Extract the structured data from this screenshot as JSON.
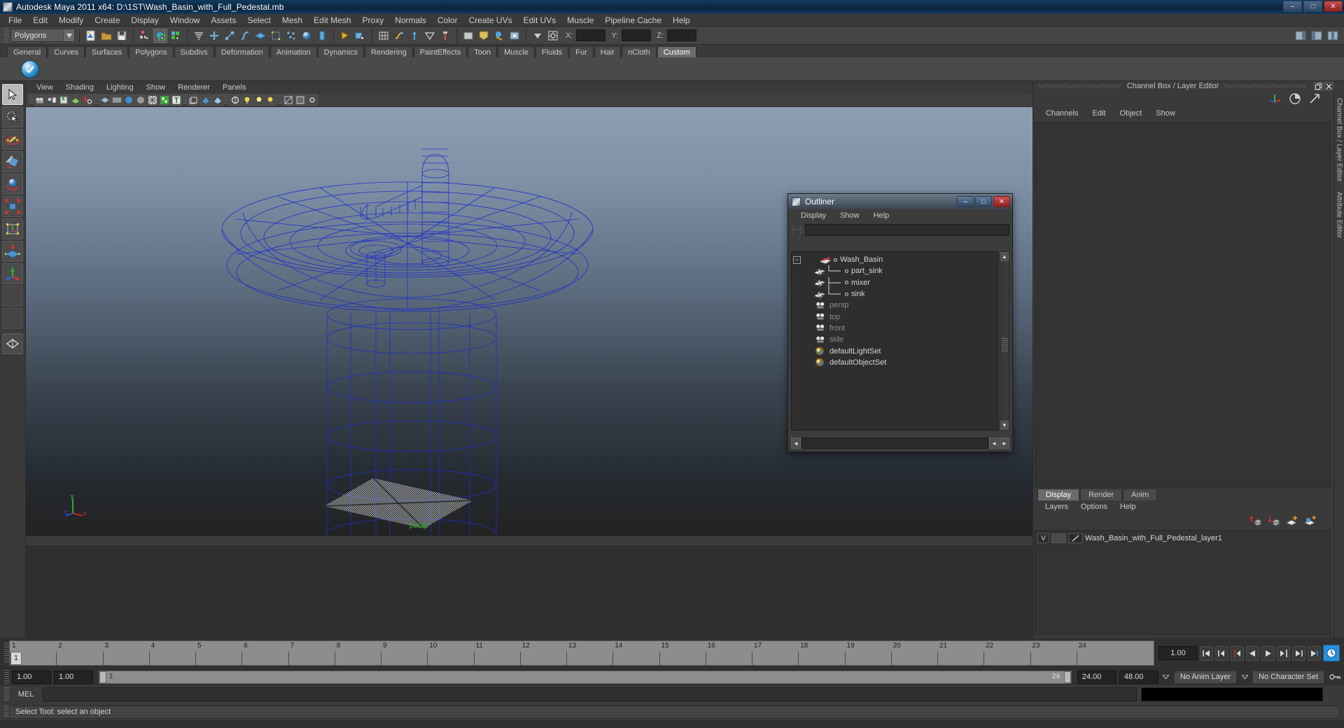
{
  "window": {
    "title": "Autodesk Maya 2011 x64: D:\\1ST\\Wash_Basin_with_Full_Pedestal.mb",
    "icon": "maya-icon",
    "minimize": "–",
    "maximize": "□",
    "close": "✕"
  },
  "menubar": {
    "items": [
      "File",
      "Edit",
      "Modify",
      "Create",
      "Display",
      "Window",
      "Assets",
      "Select",
      "Mesh",
      "Edit Mesh",
      "Proxy",
      "Normals",
      "Color",
      "Create UVs",
      "Edit UVs",
      "Muscle",
      "Pipeline Cache",
      "Help"
    ]
  },
  "statusline": {
    "menuset": "Polygons",
    "coords": {
      "x_label": "X:",
      "y_label": "Y:",
      "z_label": "Z:",
      "x_value": "",
      "y_value": "",
      "z_value": ""
    }
  },
  "shelf": {
    "tabs": [
      "General",
      "Curves",
      "Surfaces",
      "Polygons",
      "Subdivs",
      "Deformation",
      "Animation",
      "Dynamics",
      "Rendering",
      "PaintEffects",
      "Toon",
      "Muscle",
      "Fluids",
      "Fur",
      "Hair",
      "nCloth",
      "Custom"
    ],
    "active_tab": "Custom",
    "icon_name": "check-circle-icon"
  },
  "toolbox": {
    "tools": [
      "select-tool",
      "lasso-select-tool",
      "paint-select-tool",
      "move-tool",
      "rotate-tool",
      "scale-tool",
      "universal-manipulator-tool",
      "soft-modification-tool",
      "show-manipulator-tool",
      "blank-slot-1",
      "blank-slot-2"
    ],
    "selected": "select-tool"
  },
  "viewport": {
    "menus": [
      "View",
      "Shading",
      "Lighting",
      "Show",
      "Renderer",
      "Panels"
    ],
    "camera_label": "persp",
    "axis": {
      "x": "x",
      "y": "y",
      "z": "z"
    }
  },
  "outliner": {
    "title": "Outliner",
    "icon": "maya-icon",
    "minimize": "–",
    "maximize": "□",
    "close": "✕",
    "menus": [
      "Display",
      "Show",
      "Help"
    ],
    "search_value": "",
    "search_placeholder": "",
    "expand_toggle": "−",
    "tree": [
      {
        "label": "Wash_Basin",
        "icon": "transform-icon",
        "depth": 0,
        "dim": false,
        "expander": true
      },
      {
        "label": "part_sink",
        "icon": "mesh-icon",
        "depth": 1,
        "dim": false,
        "expander": false
      },
      {
        "label": "mixer",
        "icon": "mesh-icon",
        "depth": 1,
        "dim": false,
        "expander": false
      },
      {
        "label": "sink",
        "icon": "mesh-icon",
        "depth": 1,
        "dim": false,
        "expander": false
      },
      {
        "label": "persp",
        "icon": "camera-icon",
        "depth": 0,
        "dim": true,
        "expander": false
      },
      {
        "label": "top",
        "icon": "camera-icon",
        "depth": 0,
        "dim": true,
        "expander": false
      },
      {
        "label": "front",
        "icon": "camera-icon",
        "depth": 0,
        "dim": true,
        "expander": false
      },
      {
        "label": "side",
        "icon": "camera-icon",
        "depth": 0,
        "dim": true,
        "expander": false
      },
      {
        "label": "defaultLightSet",
        "icon": "set-icon",
        "depth": 0,
        "dim": false,
        "expander": false
      },
      {
        "label": "defaultObjectSet",
        "icon": "set-icon",
        "depth": 0,
        "dim": false,
        "expander": false
      }
    ],
    "scroll_up": "▲",
    "scroll_down": "▼",
    "scroll_left": "◄",
    "scroll_right": "►"
  },
  "channelbox": {
    "title": "Channel Box / Layer Editor",
    "restore_icon": "restore-icon",
    "close_icon": "close-icon",
    "menus": [
      "Channels",
      "Edit",
      "Object",
      "Show"
    ],
    "header_icons": [
      "axis-gizmo-icon",
      "half-circle-icon",
      "arrow-diagonal-icon"
    ]
  },
  "layereditor": {
    "tabs": [
      "Display",
      "Render",
      "Anim"
    ],
    "active_tab": "Display",
    "menus": [
      "Layers",
      "Options",
      "Help"
    ],
    "toolbar_icons": [
      "layer-up-icon",
      "layer-down-icon",
      "new-layer-icon",
      "new-layer-from-selected-icon"
    ],
    "layers": [
      {
        "visibility": "V",
        "playback": "",
        "type_marker": "/",
        "name": "Wash_Basin_with_Full_Pedestal_layer1"
      }
    ]
  },
  "vertical_tabs": [
    "Channel Box / Layer Editor",
    "Attribute Editor"
  ],
  "timeslider": {
    "ticks": [
      "1",
      "2",
      "3",
      "4",
      "5",
      "6",
      "7",
      "8",
      "9",
      "10",
      "11",
      "12",
      "13",
      "14",
      "15",
      "16",
      "17",
      "18",
      "19",
      "20",
      "21",
      "22",
      "23",
      "24"
    ],
    "current_frame": "1",
    "current_field": "1.00",
    "playback_buttons": [
      "go-to-start-icon",
      "step-back-keyframe-icon",
      "step-back-frame-icon",
      "play-backwards-icon",
      "play-forwards-icon",
      "step-forward-frame-icon",
      "step-forward-keyframe-icon",
      "go-to-end-icon"
    ]
  },
  "rangeslider": {
    "anim_start": "1.00",
    "range_start": "1.00",
    "bar_start_label": "1",
    "bar_end_label": "24",
    "range_end": "24.00",
    "anim_end": "48.00",
    "anim_layer": "No Anim Layer",
    "character_set": "No Character Set",
    "key_icon": "key-icon"
  },
  "commandline": {
    "language": "MEL",
    "command_value": "",
    "output_value": ""
  },
  "helpline": {
    "text": "Select Tool: select an object"
  },
  "colors": {
    "accent_blue": "#1b3d9e",
    "wire_blue": "#1f2fc8",
    "persp_green": "#22aa22",
    "title_blue": "#0b2540",
    "panel_gray": "#3a3a3a"
  }
}
